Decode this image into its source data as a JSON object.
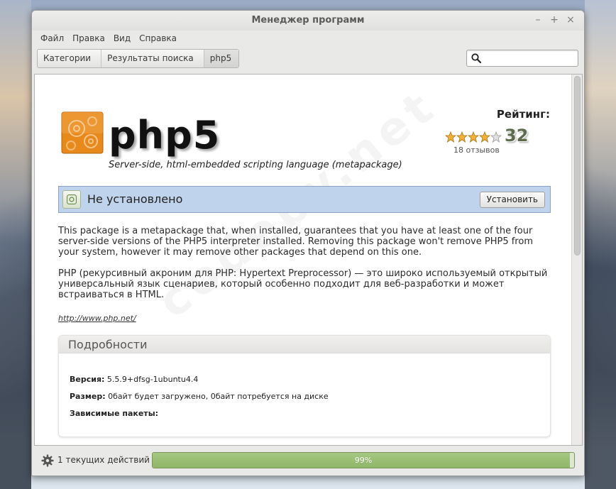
{
  "window": {
    "title": "Менеджер программ"
  },
  "menu": [
    "Файл",
    "Правка",
    "Вид",
    "Справка"
  ],
  "breadcrumb": [
    "Категории",
    "Результаты поиска",
    "php5"
  ],
  "search": {
    "value": "",
    "placeholder": ""
  },
  "package": {
    "name": "php5",
    "summary": "Server-side, html-embedded scripting language (metapackage)",
    "rating_label": "Рейтинг:",
    "rating_stars": 4,
    "rating_score": "32",
    "reviews": "18 отзывов",
    "status": "Не установлено",
    "install_label": "Установить",
    "description_en": "This package is a metapackage that, when installed, guarantees that you have at least one of the four server-side versions of the PHP5 interpreter installed. Removing this package won't remove PHP5 from your system, however it may remove other packages that depend on this one.",
    "description_ru": "PHP (рекурсивный акроним для PHP: Hypertext Preprocessor) — это широко используемый открытый универсальный язык сценариев, который особенно подходит для веб-разработки и может встраиваться в HTML.",
    "homepage": "http://www.php.net/"
  },
  "details": {
    "title": "Подробности",
    "version_label": "Версия:",
    "version_value": "5.5.9+dfsg-1ubuntu4.4",
    "size_label": "Размер:",
    "size_value": "0байт будет загружено, 0байт потребуется на диске",
    "deps_label": "Зависимые пакеты:"
  },
  "footer": {
    "actions_text": "1 текущих действий",
    "progress_percent": 99,
    "progress_label": "99%"
  },
  "colors": {
    "status_bg": "#bfd3ec",
    "progress_fill": "#8fb668",
    "icon_orange": "#e8891c"
  },
  "icons": [
    "search-icon",
    "gear-icon",
    "package-icon",
    "star-icon",
    "not-installed-icon",
    "minimize-icon",
    "maximize-icon",
    "close-icon"
  ]
}
